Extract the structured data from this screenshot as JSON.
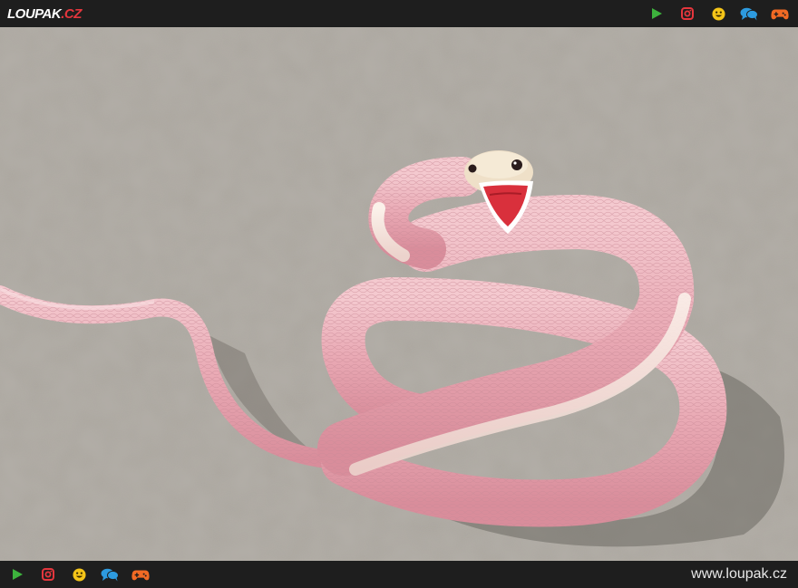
{
  "header": {
    "logo_main": "LOUPAK",
    "logo_tld": ".CZ"
  },
  "icons": {
    "play": "play-icon",
    "instagram": "instagram-icon",
    "smiley": "smiley-icon",
    "chat": "chat-bubbles-icon",
    "gamepad": "gamepad-icon"
  },
  "colors": {
    "bar_bg": "#1e1e1e",
    "play": "#3db33d",
    "instagram": "#e4363d",
    "smiley": "#f5c518",
    "chat": "#2d9be0",
    "gamepad": "#f26a24",
    "logo_tld": "#e4363d"
  },
  "footer": {
    "site_url": "www.loupak.cz"
  }
}
